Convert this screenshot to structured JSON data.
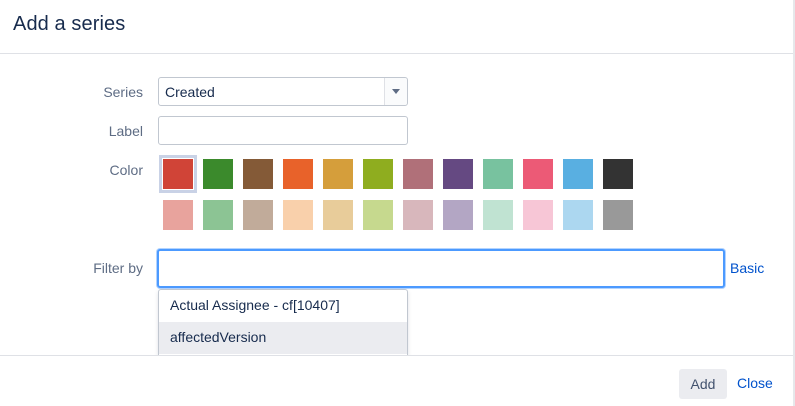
{
  "dialog": {
    "title": "Add a series"
  },
  "form": {
    "series": {
      "label": "Series",
      "value": "Created"
    },
    "label_field": {
      "label": "Label",
      "value": ""
    },
    "color": {
      "label": "Color",
      "selected_index": 0,
      "row1": [
        "#d04437",
        "#3b8a2c",
        "#845a37",
        "#e8622a",
        "#d59e3b",
        "#8fad1f",
        "#b07079",
        "#654982",
        "#78c29f",
        "#ec5a76",
        "#59afe1",
        "#333333"
      ],
      "row2": [
        "#e8a39d",
        "#8cc494",
        "#c1ab9a",
        "#f9d0ab",
        "#e8cc9a",
        "#c6d98e",
        "#d8b7bc",
        "#b3a6c4",
        "#c0e3d2",
        "#f7c6d6",
        "#acd7f0",
        "#999999"
      ]
    },
    "filter": {
      "label": "Filter by",
      "value": "",
      "basic_link": "Basic"
    }
  },
  "autocomplete": {
    "items": [
      "Actual Assignee - cf[10407]",
      "affectedVersion"
    ],
    "hover_index": 1
  },
  "footer": {
    "add_label": "Add",
    "close_label": "Close"
  }
}
